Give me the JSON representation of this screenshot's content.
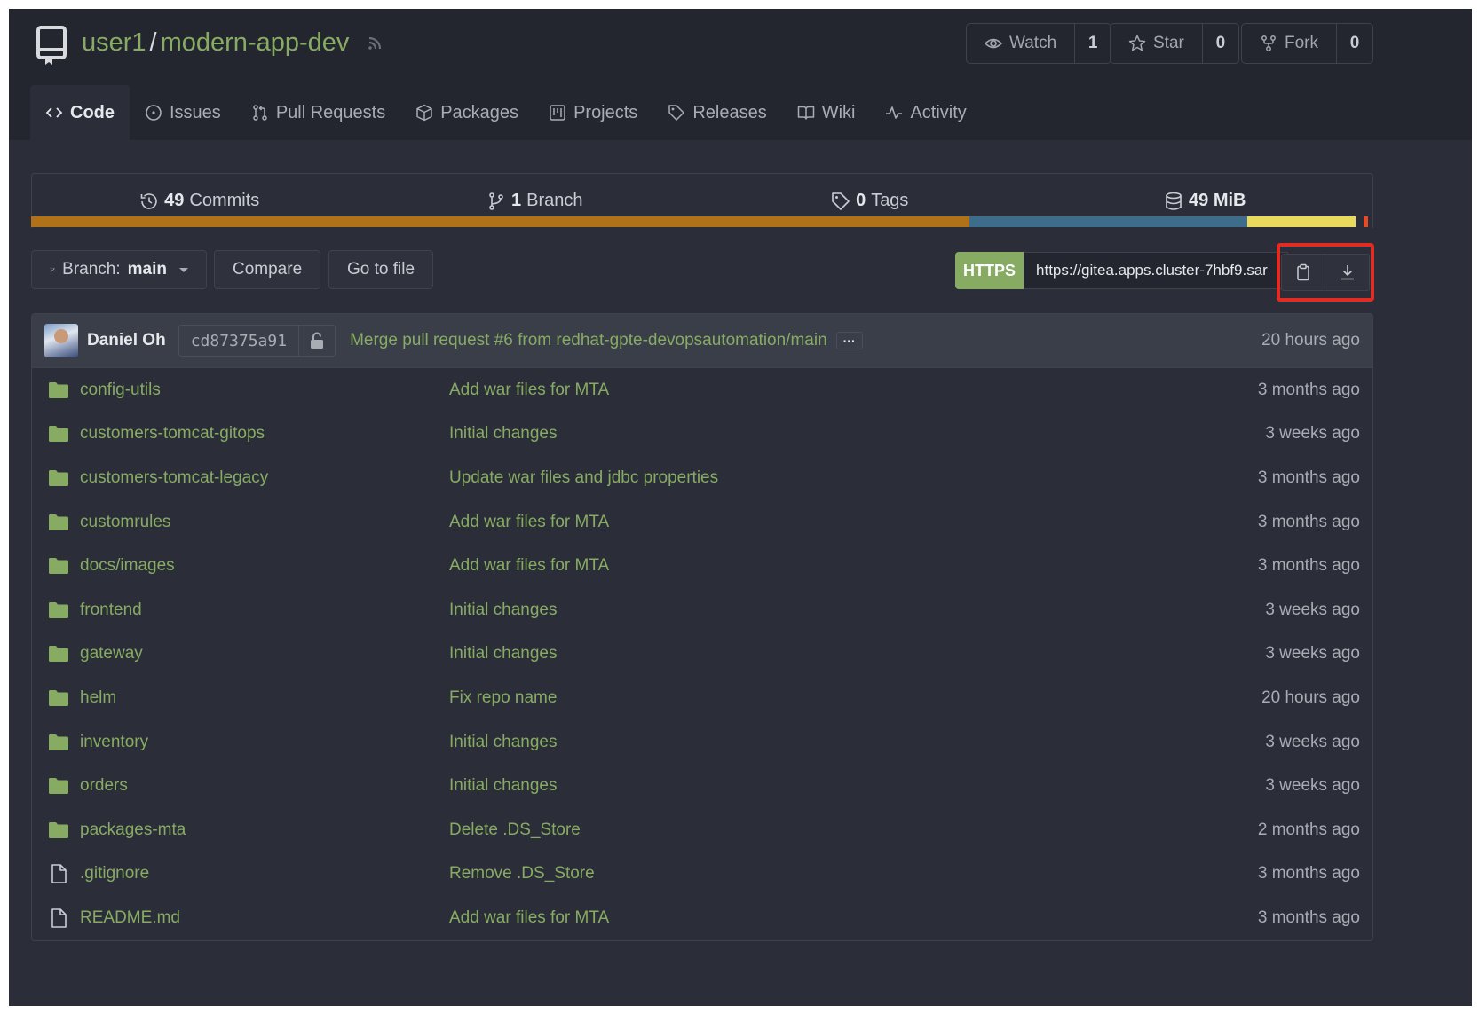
{
  "repo": {
    "owner": "user1",
    "separator": "/",
    "name": "modern-app-dev"
  },
  "actions": [
    {
      "label": "Watch",
      "count": "1",
      "icon": "eye-icon"
    },
    {
      "label": "Star",
      "count": "0",
      "icon": "star-icon"
    },
    {
      "label": "Fork",
      "count": "0",
      "icon": "fork-icon"
    }
  ],
  "tabs": [
    {
      "label": "Code",
      "icon": "code-icon",
      "active": true
    },
    {
      "label": "Issues",
      "icon": "issue-icon"
    },
    {
      "label": "Pull Requests",
      "icon": "pull-request-icon"
    },
    {
      "label": "Packages",
      "icon": "package-icon"
    },
    {
      "label": "Projects",
      "icon": "project-icon"
    },
    {
      "label": "Releases",
      "icon": "tag-icon"
    },
    {
      "label": "Wiki",
      "icon": "book-icon"
    },
    {
      "label": "Activity",
      "icon": "pulse-icon"
    }
  ],
  "stats": {
    "commits": {
      "count": "49",
      "label": "Commits"
    },
    "branches": {
      "count": "1",
      "label": "Branch"
    },
    "tags": {
      "count": "0",
      "label": "Tags"
    },
    "size": {
      "count": "49 MiB"
    }
  },
  "languages": [
    {
      "color": "#b07219",
      "percent": 69.9
    },
    {
      "color": "#3d6d8a",
      "percent": 20.7
    },
    {
      "color": "#e9da5e",
      "percent": 8.1
    },
    {
      "color": "#2b2e38",
      "percent": 0.6
    },
    {
      "color": "#e34c26",
      "percent": 0.3
    }
  ],
  "toolbar": {
    "branch_prefix": "Branch:",
    "branch_name": "main",
    "compare_label": "Compare",
    "goto_label": "Go to file",
    "clone_protocol": "HTTPS",
    "clone_url": "https://gitea.apps.cluster-7hbf9.sar"
  },
  "latest_commit": {
    "author": "Daniel Oh",
    "sha": "cd87375a91",
    "message": "Merge pull request #6 from redhat-gpte-devopsautomation/main",
    "ellipsis": "···",
    "time": "20 hours ago"
  },
  "files": [
    {
      "type": "folder",
      "name": "config-utils",
      "message": "Add war files for MTA",
      "time": "3 months ago"
    },
    {
      "type": "folder",
      "name": "customers-tomcat-gitops",
      "message": "Initial changes",
      "time": "3 weeks ago"
    },
    {
      "type": "folder",
      "name": "customers-tomcat-legacy",
      "message": "Update war files and jdbc properties",
      "time": "3 months ago"
    },
    {
      "type": "folder",
      "name": "customrules",
      "message": "Add war files for MTA",
      "time": "3 months ago"
    },
    {
      "type": "folder",
      "name": "docs/images",
      "message": "Add war files for MTA",
      "time": "3 months ago"
    },
    {
      "type": "folder",
      "name": "frontend",
      "message": "Initial changes",
      "time": "3 weeks ago"
    },
    {
      "type": "folder",
      "name": "gateway",
      "message": "Initial changes",
      "time": "3 weeks ago"
    },
    {
      "type": "folder",
      "name": "helm",
      "message": "Fix repo name",
      "time": "20 hours ago"
    },
    {
      "type": "folder",
      "name": "inventory",
      "message": "Initial changes",
      "time": "3 weeks ago"
    },
    {
      "type": "folder",
      "name": "orders",
      "message": "Initial changes",
      "time": "3 weeks ago"
    },
    {
      "type": "folder",
      "name": "packages-mta",
      "message": "Delete .DS_Store",
      "time": "2 months ago"
    },
    {
      "type": "file",
      "name": ".gitignore",
      "message": "Remove .DS_Store",
      "time": "3 months ago"
    },
    {
      "type": "file",
      "name": "README.md",
      "message": "Add war files for MTA",
      "time": "3 months ago"
    }
  ],
  "colors": {
    "accent": "#87ab63",
    "highlight": "#e22b22",
    "background": "#2b2e38",
    "header": "#23262e"
  }
}
